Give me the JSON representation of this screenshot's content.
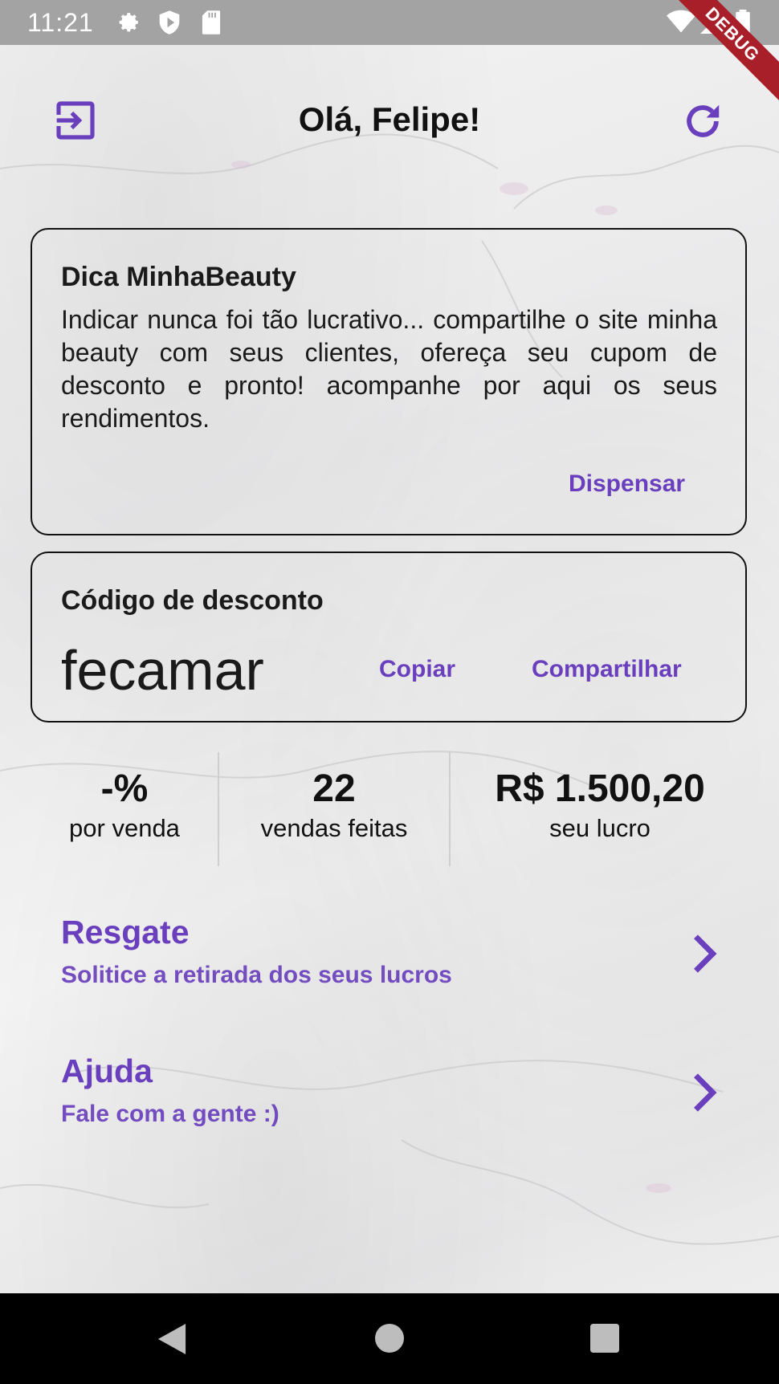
{
  "status_bar": {
    "time": "11:21",
    "icons": [
      "gear-icon",
      "shield-icon",
      "sd-card-icon",
      "wifi-icon",
      "signal-icon",
      "battery-icon"
    ],
    "debug_label": "DEBUG"
  },
  "header": {
    "title": "Olá, Felipe!",
    "left_icon": "logout-icon",
    "right_icon": "refresh-icon"
  },
  "tip_card": {
    "title": "Dica MinhaBeauty",
    "text": "Indicar nunca foi tão lucrativo... compartilhe o site minha beauty com seus clientes, ofereça seu cupom de desconto e pronto! acompanhe por aqui os seus rendimentos.",
    "dismiss_label": "Dispensar"
  },
  "code_card": {
    "title": "Código de desconto",
    "code": "fecamar",
    "copy_label": "Copiar",
    "share_label": "Compartilhar"
  },
  "stats": [
    {
      "value": "-%",
      "label": "por venda"
    },
    {
      "value": "22",
      "label": "vendas feitas"
    },
    {
      "value": "R$ 1.500,20",
      "label": "seu lucro"
    }
  ],
  "menu": [
    {
      "title": "Resgate",
      "subtitle": "Solitice a retirada dos seus lucros",
      "icon": "chevron-right-icon"
    },
    {
      "title": "Ajuda",
      "subtitle": "Fale com a gente :)",
      "icon": "chevron-right-icon"
    }
  ],
  "nav_bar": {
    "buttons": [
      "back-icon",
      "home-icon",
      "recents-icon"
    ]
  },
  "colors": {
    "accent": "#6a3fbd",
    "status_bar": "#a3a3a3",
    "debug_ribbon": "#a81f2a",
    "nav_bar": "#000000"
  }
}
